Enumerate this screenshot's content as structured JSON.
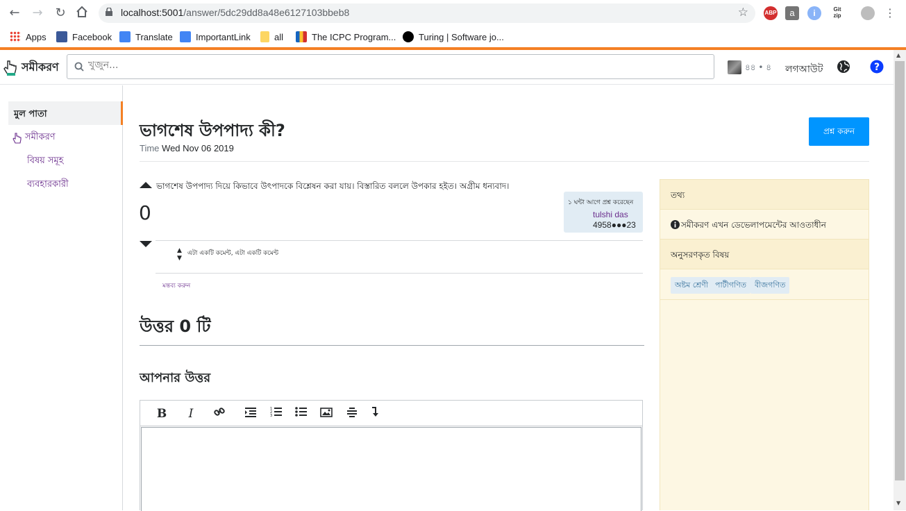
{
  "browser": {
    "url_host": "localhost:5001",
    "url_path": "/answer/5dc29dd8a48e6127103bbeb8",
    "bookmarks": [
      {
        "label": "Apps",
        "color": "#ea4335"
      },
      {
        "label": "Facebook",
        "color": "#3b5998"
      },
      {
        "label": "Translate",
        "color": "#4285f4"
      },
      {
        "label": "ImportantLink",
        "color": "#4285f4"
      },
      {
        "label": "all",
        "color": "#fbc02d"
      },
      {
        "label": "The ICPC Program...",
        "color": "#1565c0"
      },
      {
        "label": "Turing | Software jo...",
        "color": "#000000"
      }
    ],
    "extensions": {
      "abp": "ABP",
      "a": "a",
      "gitzip": "Git zip"
    }
  },
  "header": {
    "brand": "সমীকরণ",
    "search_placeholder": "খুজুন...",
    "user_rep": "৪৪ • ৪",
    "logout": "লগআউট"
  },
  "sidebar": {
    "home": "মুল পাতা",
    "brand_link": "সমীকরণ",
    "topics": "বিষয় সমূহ",
    "users": "ব্যবহারকারী"
  },
  "question": {
    "title": "ভাগশেষ উপপাদ্য কী?",
    "time_label": "Time",
    "time_value": "Wed Nov 06 2019",
    "ask_button": "প্রশ্ন করুন",
    "body": "ভাগশেষ উপপাদ্য দিয়ে কিভাবে উৎপাদকে বিশ্লেষন করা যায়। বিস্তারিত বললে উপকার হইত। অগ্রীম ধন্যবাদ।",
    "votes": "0",
    "asked_ago": "১ ঘন্টা আগে প্রশ্ন করেছেন",
    "owner_name": "tulshi das",
    "owner_rep": "4958●●●23",
    "comment_text": "এটা একটি কমেন্ট, এটা একটি কমেন্ট",
    "add_comment": "মন্তব্য করুন"
  },
  "answers": {
    "heading_prefix": "উত্তর",
    "count": "0",
    "heading_suffix": "টি",
    "your_answer": "আপনার উত্তর"
  },
  "info_panel": {
    "info_head": "তথ্য",
    "info_row": "সমীকরণ এখন ডেভেলাপমেন্টের আওতাধীন",
    "followed_head": "অনুসরণকৃত বিষয়",
    "tags": [
      "অষ্টম শ্রেণী",
      "পাটীগণিত",
      "বীজগণিত"
    ]
  }
}
